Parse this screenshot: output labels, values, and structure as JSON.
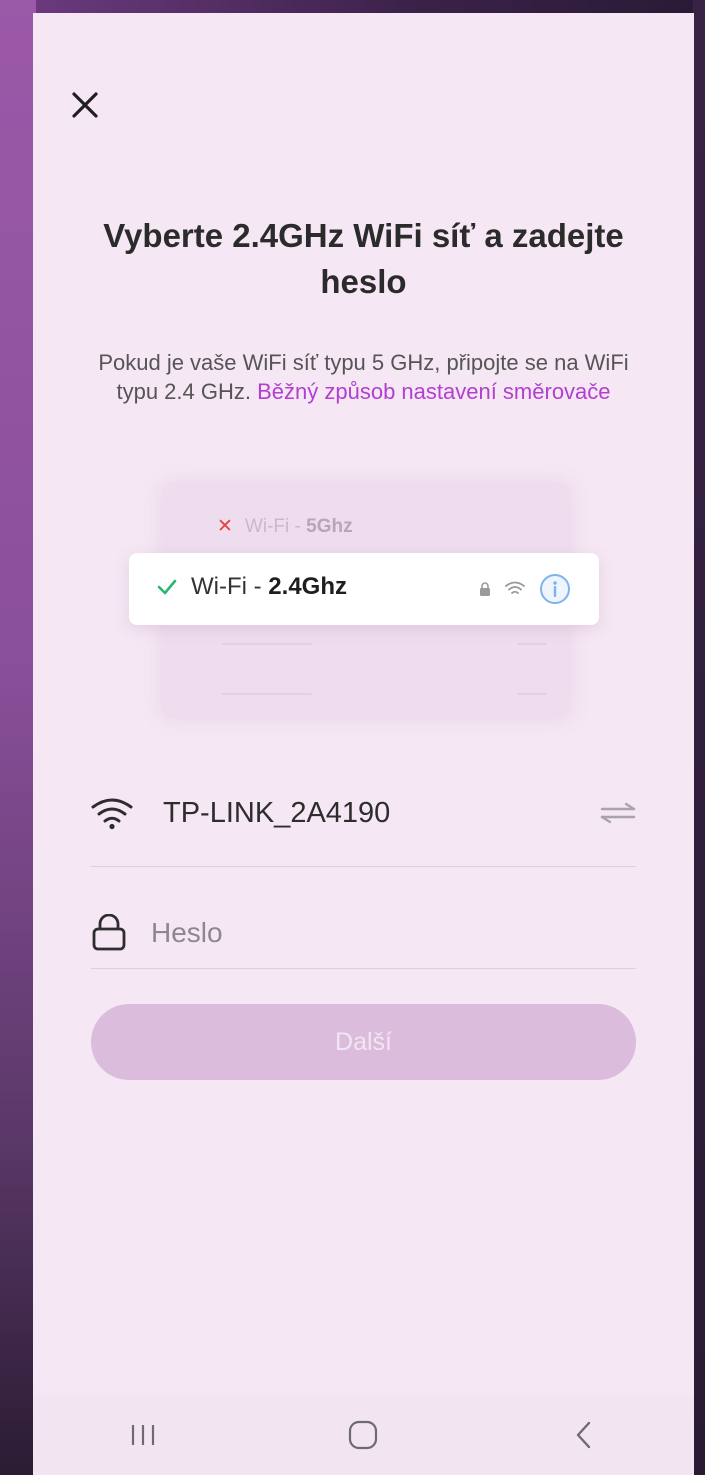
{
  "screen": {
    "title": "Vyberte 2.4GHz WiFi síť a zadejte heslo",
    "subtitle_text": "Pokud je vaše WiFi síť typu 5 GHz, připojte se na WiFi typu 2.4 GHz.",
    "subtitle_link": "Běžný způsob nastavení směrovače"
  },
  "illustration": {
    "bad_network_prefix": "Wi-Fi - ",
    "bad_network_band": "5Ghz",
    "good_network_prefix": "Wi-Fi - ",
    "good_network_band": "2.4Ghz"
  },
  "form": {
    "ssid_value": "TP-LINK_2A4190",
    "password_placeholder": "Heslo",
    "password_value": "",
    "next_label": "Další"
  },
  "icons": {
    "close": "close-icon",
    "wifi": "wifi-icon",
    "switch_network": "swap-arrows-icon",
    "lock": "lock-icon",
    "nav_recents": "recents-icon",
    "nav_home": "home-icon",
    "nav_back": "back-icon"
  },
  "colors": {
    "accent_link": "#b23fd0",
    "button_disabled": "#dbbcdc",
    "background": "#f6e7f4",
    "check_green": "#2bb673",
    "cross_red": "#e84040"
  }
}
